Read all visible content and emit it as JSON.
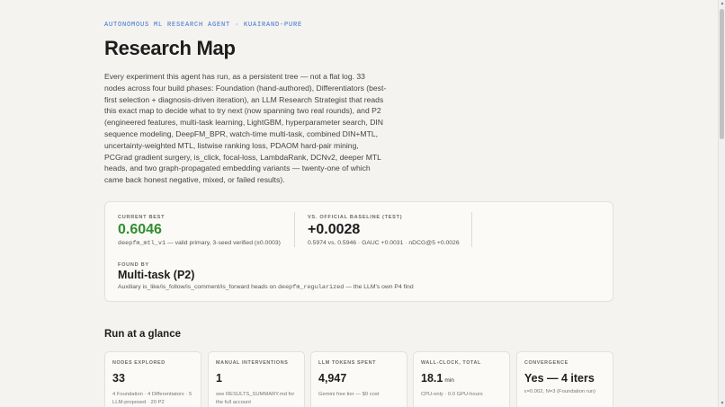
{
  "header": {
    "eyebrow": "AUTONOMOUS ML RESEARCH AGENT · KUAIRAND-PURE",
    "title": "Research Map",
    "intro": "Every experiment this agent has run, as a persistent tree — not a flat log. 33 nodes across four build phases: Foundation (hand-authored), Differentiators (best-first selection + diagnosis-driven iteration), an LLM Research Strategist that reads this exact map to decide what to try next (now spanning two real rounds), and P2 (engineered features, multi-task learning, LightGBM, hyperparameter search, DIN sequence modeling, DeepFM_BPR, watch-time multi-task, combined DIN+MTL, uncertainty-weighted MTL, listwise ranking loss, PDAOM hard-pair mining, PCGrad gradient surgery, is_click, focal-loss, LambdaRank, DCNv2, deeper MTL heads, and two graph-propagated embedding variants — twenty-one of which came back honest negative, mixed, or failed results)."
  },
  "summary": {
    "best": {
      "label": "CURRENT BEST",
      "value": "0.6046",
      "node": "deepfm_mtl_v1",
      "note": " — valid primary, 3-seed verified (±0.0003)"
    },
    "baseline": {
      "label": "VS. OFFICIAL BASELINE (TEST)",
      "value": "+0.0028",
      "note": "0.5974 vs. 0.5946 · GAUC +0.0031 · nDCG@5 +0.0026"
    },
    "found_by": {
      "label": "FOUND BY",
      "value": "Multi-task (P2)",
      "note_pre": "Auxiliary is_like/is_follow/is_comment/is_forward heads on ",
      "note_code": "deepfm_regularized",
      "note_post": " — the LLM's own P4 find"
    }
  },
  "glance": {
    "title": "Run at a glance",
    "cards": [
      {
        "label": "NODES EXPLORED",
        "value": "33",
        "unit": "",
        "note": "4 Foundation · 4 Differentiators · 5 LLM-proposed · 20 P2"
      },
      {
        "label": "MANUAL INTERVENTIONS",
        "value": "1",
        "unit": "",
        "note": "see RESULTS_SUMMARY.md for the full account"
      },
      {
        "label": "LLM TOKENS SPENT",
        "value": "4,947",
        "unit": "",
        "note": "Gemini free tier — $0 cost"
      },
      {
        "label": "WALL-CLOCK, TOTAL",
        "value": "18.1",
        "unit": "min",
        "note": "CPU-only · 0.0 GPU-hours"
      },
      {
        "label": "CONVERGENCE",
        "value": "Yes — 4 iters",
        "unit": "",
        "note": "ε=0.002, N=3 (Foundation run)"
      }
    ]
  },
  "colors": {
    "accent_blue": "#3b6fd1",
    "best_green": "#2f8f2f",
    "background": "#f4f3ef"
  },
  "scrollbar": {
    "up_icon": "▲",
    "down_icon": "▼"
  }
}
